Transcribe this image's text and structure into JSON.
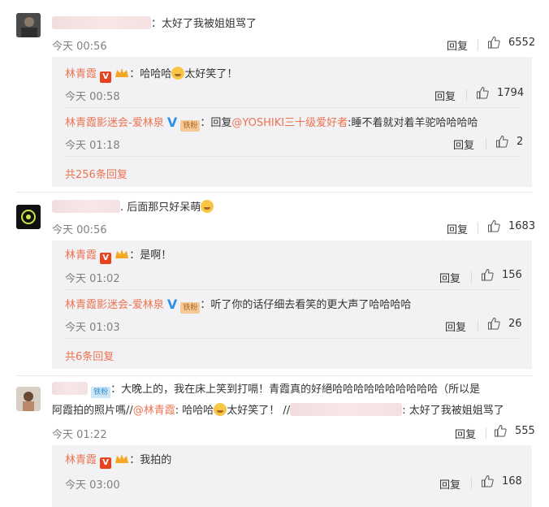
{
  "comments": [
    {
      "text": "：太好了我被姐姐骂了",
      "time": "今天 00:56",
      "reply_label": "回复",
      "likes": "6552",
      "replies": [
        {
          "user": "林青霞",
          "text": "：哈哈哈",
          "text2": "太好笑了！",
          "time": "今天 00:58",
          "reply_label": "回复",
          "likes": "1794"
        },
        {
          "user": "林青霞影迷会-爱林泉",
          "fan_badge": "铁粉",
          "text_prefix": "：回复",
          "mention": "@YOSHIKI三十级爱好者",
          "text": ":睡不着就对着羊驼哈哈哈哈",
          "time": "今天 01:18",
          "reply_label": "回复",
          "likes": "2"
        }
      ],
      "more_replies": "共256条回复"
    },
    {
      "text": ". 后面那只好呆萌",
      "time": "今天 00:56",
      "reply_label": "回复",
      "likes": "1683",
      "replies": [
        {
          "user": "林青霞",
          "text": "：是啊！",
          "time": "今天 01:02",
          "reply_label": "回复",
          "likes": "156"
        },
        {
          "user": "林青霞影迷会-爱林泉",
          "fan_badge": "铁粉",
          "text": "：听了你的话仔细去看笑的更大声了哈哈哈哈",
          "time": "今天 01:03",
          "reply_label": "回复",
          "likes": "26"
        }
      ],
      "more_replies": "共6条回复"
    },
    {
      "fan_badge": "铁粉",
      "text_line1": "：大晚上的，我在床上笑到打嗝！青霞真的好絕哈哈哈哈哈哈哈哈哈哈（所以是",
      "text_line2_a": "阿霞拍的照片嗎//",
      "mention": "@林青霞",
      "text_line2_b": ": 哈哈哈",
      "text_line2_c": "太好笑了！ //",
      "text_line2_d": ": 太好了我被姐姐骂了",
      "time": "今天 01:22",
      "reply_label": "回复",
      "likes": "555",
      "replies": [
        {
          "user": "林青霞",
          "text": "：我拍的",
          "time": "今天 03:00",
          "reply_label": "回复",
          "likes": "168"
        }
      ]
    }
  ],
  "colors": {
    "accent": "#eb7350",
    "panel": "#f2f2f5",
    "meta": "#808080"
  }
}
